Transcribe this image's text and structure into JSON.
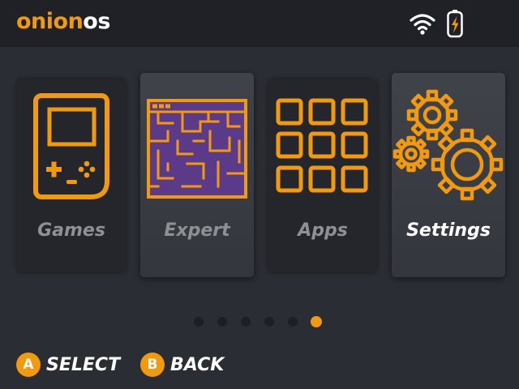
{
  "header": {
    "logo_part1": "onion",
    "logo_part2": "os",
    "status_icons": [
      "wifi-icon",
      "battery-charging-icon"
    ]
  },
  "menu": {
    "items": [
      {
        "label": "Games",
        "icon": "handheld-console-icon",
        "selected": false
      },
      {
        "label": "Expert",
        "icon": "maze-icon",
        "selected": true
      },
      {
        "label": "Apps",
        "icon": "app-grid-icon",
        "selected": false
      },
      {
        "label": "Settings",
        "icon": "gears-icon",
        "selected": true
      }
    ]
  },
  "pagination": {
    "total_pages": 6,
    "current_page": 6
  },
  "footer": {
    "a_button": "A",
    "a_label": "SELECT",
    "b_button": "B",
    "b_label": "BACK"
  },
  "colors": {
    "accent": "#f29a0d",
    "background": "#2a2d33",
    "header": "#1f2126",
    "maze_fill": "#5b3a8a",
    "label_inactive": "#8f9094",
    "label_active": "#ffffff"
  }
}
